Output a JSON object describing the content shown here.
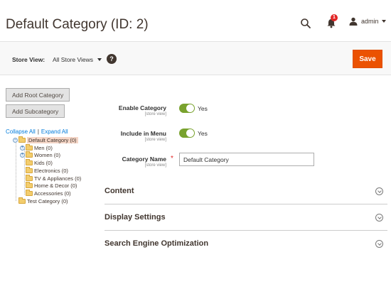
{
  "header": {
    "title": "Default Category (ID: 2)",
    "notifications_count": "1",
    "username": "admin"
  },
  "store_bar": {
    "label": "Store View:",
    "selected": "All Store Views",
    "help": "?",
    "save_label": "Save"
  },
  "left": {
    "add_root_label": "Add Root Category",
    "add_sub_label": "Add Subcategory",
    "collapse_all": "Collapse All",
    "separator": "|",
    "expand_all": "Expand All",
    "tree": [
      {
        "label": "Default Category (0)",
        "selected": true
      },
      {
        "label": "Men (0)"
      },
      {
        "label": "Women (0)"
      },
      {
        "label": "Kids (0)"
      },
      {
        "label": "Electronics (0)"
      },
      {
        "label": "TV & Appliances (0)"
      },
      {
        "label": "Home & Decor (0)"
      },
      {
        "label": "Accessories (0)"
      },
      {
        "label": "Test Category (0)"
      }
    ]
  },
  "form": {
    "enable_category": {
      "label": "Enable Category",
      "scope": "[store view]",
      "value": "Yes"
    },
    "include_in_menu": {
      "label": "Include in Menu",
      "scope": "[store view]",
      "value": "Yes"
    },
    "category_name": {
      "label": "Category Name",
      "scope": "[store view]",
      "value": "Default Category",
      "required_mark": "*"
    }
  },
  "sections": [
    "Content",
    "Display Settings",
    "Search Engine Optimization"
  ],
  "colors": {
    "save": "#eb5202",
    "toggle_on": "#79a22e",
    "link": "#007bdb",
    "badge": "#e22626"
  }
}
